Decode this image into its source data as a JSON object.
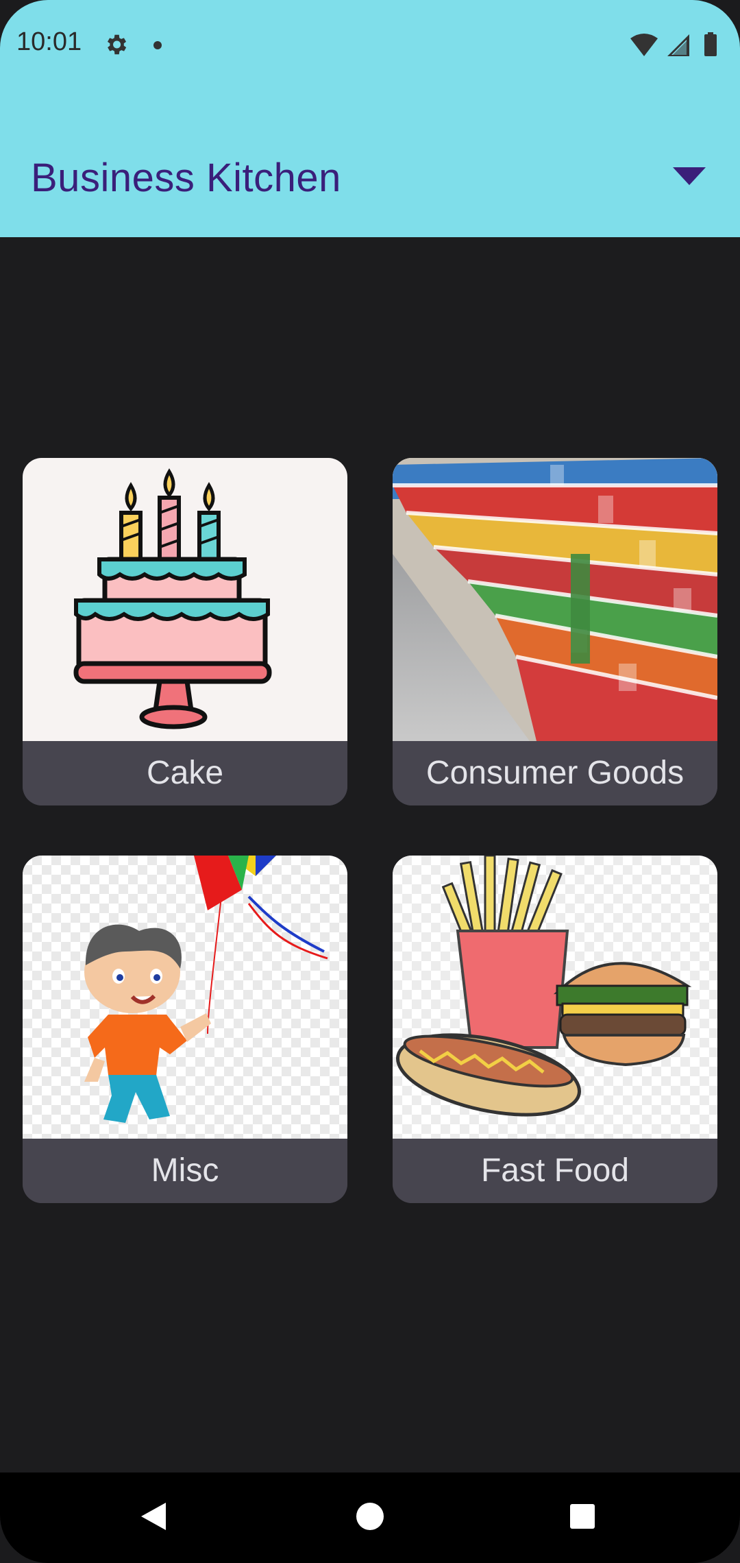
{
  "status_bar": {
    "time": "10:01",
    "icons": [
      "gear-icon",
      "notification-dot-icon",
      "wifi-icon",
      "signal-icon",
      "battery-icon"
    ]
  },
  "app_bar": {
    "title": "Business Kitchen",
    "dropdown_icon": "dropdown-arrow-icon"
  },
  "categories": [
    {
      "label": "Cake",
      "image": "cake-image"
    },
    {
      "label": "Consumer Goods",
      "image": "grocery-aisle-image"
    },
    {
      "label": "Misc",
      "image": "boy-with-kite-image"
    },
    {
      "label": "Fast Food",
      "image": "fast-food-image"
    }
  ],
  "nav_bar": {
    "buttons": [
      "back-icon",
      "home-icon",
      "recents-icon"
    ]
  },
  "colors": {
    "accent": "#7fdeea",
    "title": "#3a1f7a",
    "background": "#1c1c1e",
    "card_label_bg": "#47454f",
    "card_label_text": "#e4e4e9"
  }
}
